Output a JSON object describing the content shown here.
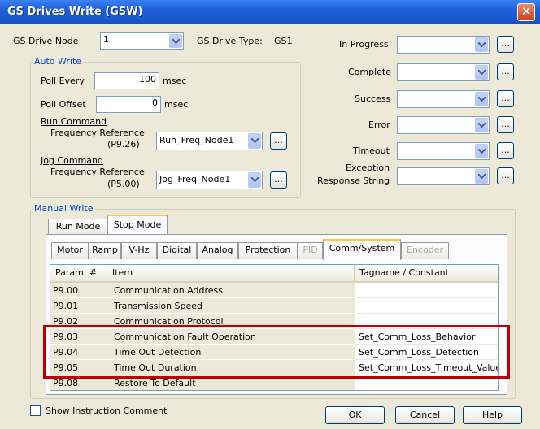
{
  "window": {
    "title": "GS Drives Write (GSW)",
    "close_label": "✕"
  },
  "top": {
    "drive_node_label": "GS Drive Node",
    "drive_node_value": "1",
    "drive_type_label": "GS Drive Type:",
    "drive_type_value": "GS1"
  },
  "auto_write": {
    "title": "Auto Write",
    "poll_every_label": "Poll Every",
    "poll_every_value": "100",
    "poll_every_unit": "msec",
    "poll_offset_label": "Poll Offset",
    "poll_offset_value": "0",
    "poll_offset_unit": "msec",
    "run_command_label": "Run Command",
    "run_freq_label": "Frequency Reference",
    "run_freq_param": "(P9.26)",
    "run_freq_value": "Run_Freq_Node1",
    "jog_command_label": "Jog Command",
    "jog_freq_label": "Frequency Reference",
    "jog_freq_param": "(P5.00)",
    "jog_freq_value": "Jog_Freq_Node1",
    "ellipsis": "..."
  },
  "status": {
    "in_progress": "In Progress",
    "complete": "Complete",
    "success": "Success",
    "error": "Error",
    "timeout": "Timeout",
    "exception_line1": "Exception",
    "exception_line2": "Response String",
    "ellipsis": "..."
  },
  "manual_write": {
    "title": "Manual Write",
    "mode_tabs": [
      "Run Mode",
      "Stop Mode"
    ],
    "sub_tabs": [
      "Motor",
      "Ramp",
      "V-Hz",
      "Digital",
      "Analog",
      "Protection",
      "PID",
      "Comm/System",
      "Encoder"
    ],
    "columns": [
      "Param. #",
      "Item",
      "Tagname / Constant"
    ],
    "rows": [
      {
        "param": "P9.00",
        "item": "Communication Address",
        "tag": ""
      },
      {
        "param": "P9.01",
        "item": "Transmission Speed",
        "tag": ""
      },
      {
        "param": "P9.02",
        "item": "Communication Protocol",
        "tag": ""
      },
      {
        "param": "P9.03",
        "item": "Communication Fault Operation",
        "tag": "Set_Comm_Loss_Behavior"
      },
      {
        "param": "P9.04",
        "item": "Time Out Detection",
        "tag": "Set_Comm_Loss_Detection"
      },
      {
        "param": "P9.05",
        "item": "Time Out Duration",
        "tag": "Set_Comm_Loss_Timeout_Value"
      },
      {
        "param": "P9.08",
        "item": "Restore To Default",
        "tag": ""
      }
    ]
  },
  "footer": {
    "show_comment_label": "Show Instruction Comment",
    "ok": "OK",
    "cancel": "Cancel",
    "help": "Help"
  },
  "colors": {
    "titlebar": "#1f5fd8",
    "group_title": "#0046d5",
    "highlight_box": "#c00000",
    "tab_selected_accent": "#ffc83c"
  }
}
